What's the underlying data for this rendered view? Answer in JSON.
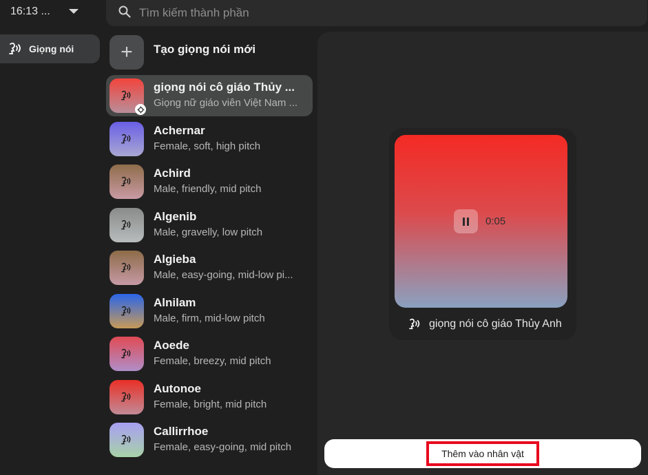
{
  "status": {
    "time": "16:13 ..."
  },
  "search": {
    "placeholder": "Tìm kiếm thành phần",
    "icon": "search-icon"
  },
  "nav": {
    "items": [
      {
        "label": "Giọng nói",
        "icon": "voice-icon",
        "active": true
      }
    ]
  },
  "create": {
    "label": "Tạo giọng nói mới",
    "icon": "plus-icon"
  },
  "voices": [
    {
      "name": "giọng nói cô giáo Thủy ...",
      "desc": "Giọng nữ giáo viên Việt Nam ...",
      "gradient": [
        "#f2443c",
        "#b98e9a"
      ],
      "selected": true,
      "custom": true
    },
    {
      "name": "Achernar",
      "desc": "Female, soft, high pitch",
      "gradient": [
        "#6a5fe6",
        "#a9a7d2"
      ]
    },
    {
      "name": "Achird",
      "desc": "Male, friendly, mid pitch",
      "gradient": [
        "#8f6d4a",
        "#c99aa4"
      ]
    },
    {
      "name": "Algenib",
      "desc": "Male, gravelly, low pitch",
      "gradient": [
        "#8a8a8a",
        "#b8bcbc"
      ]
    },
    {
      "name": "Algieba",
      "desc": "Male, easy-going, mid-low pi...",
      "gradient": [
        "#8d6b48",
        "#c69aa6"
      ]
    },
    {
      "name": "Alnilam",
      "desc": "Male, firm, mid-low pitch",
      "gradient": [
        "#2b65e8",
        "#c79a58"
      ]
    },
    {
      "name": "Aoede",
      "desc": "Female, breezy, mid pitch",
      "gradient": [
        "#e04a54",
        "#b08ec8"
      ]
    },
    {
      "name": "Autonoe",
      "desc": "Female, bright, mid pitch",
      "gradient": [
        "#e93027",
        "#c28a96"
      ]
    },
    {
      "name": "Callirrhoe",
      "desc": "Female, easy-going, mid pitch",
      "gradient": [
        "#a89ff2",
        "#a8d2a8"
      ]
    }
  ],
  "player": {
    "elapsed": "0:05",
    "voice_name": "giọng nói cô giáo Thủy Anh",
    "pause_icon": "pause-icon"
  },
  "action": {
    "add_label": "Thêm vào nhân vật",
    "highlight_color": "#e8091e"
  }
}
